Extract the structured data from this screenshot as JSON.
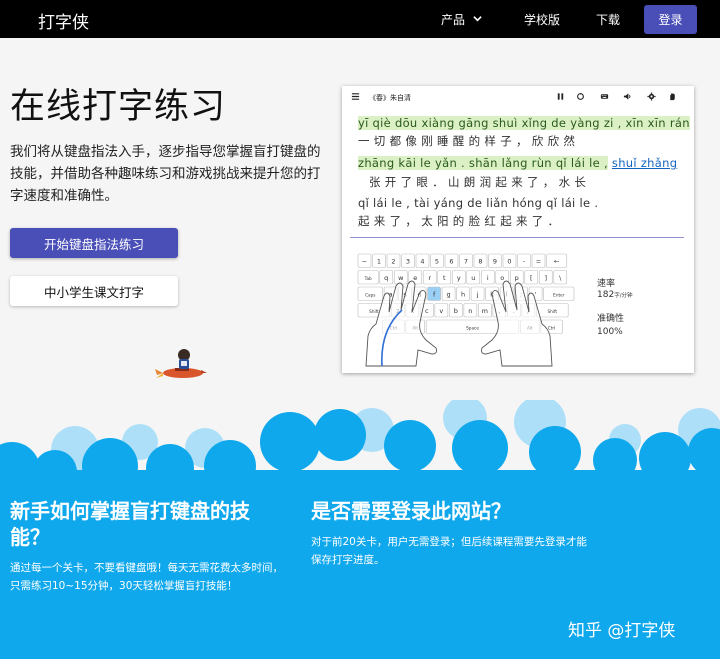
{
  "header": {
    "brand": "打字侠",
    "nav": {
      "product": "产品",
      "school": "学校版",
      "download": "下载",
      "login": "登录"
    }
  },
  "hero": {
    "title": "在线打字练习",
    "description": "我们将从键盘指法入手，逐步指导您掌握盲打键盘的技能，并借助各种趣味练习和游戏挑战来提升您的打字速度和准确性。",
    "primary_button": "开始键盘指法练习",
    "secondary_button": "中小学生课文打字"
  },
  "preview": {
    "title": "《春》朱自清",
    "lines": [
      {
        "pinyin_done": "yī qiè dōu xiàng gāng shuì xǐng de yàng zi , xīn xīn rán",
        "pinyin_rest": "",
        "hanzi": "一切都像刚睡醒的样子，欣欣然"
      },
      {
        "pinyin_done": "zhāng kāi le yǎn . shān lǎng rùn qǐ lái le ,",
        "pinyin_rest": "shuǐ zhǎng",
        "hanzi": "张开了眼．山朗润起来了，水长"
      },
      {
        "pinyin_done": "",
        "pinyin_rest": "qǐ lái le , tài yáng de liǎn hóng qǐ lái le .",
        "hanzi": "起来了，太阳的脸红起来了．"
      }
    ],
    "stats": {
      "speed_label": "速率",
      "speed_value": "182",
      "speed_unit": "字/分钟",
      "accuracy_label": "准确性",
      "accuracy_value": "100%"
    },
    "keyboard_rows": [
      [
        "~",
        "1",
        "2",
        "3",
        "4",
        "5",
        "6",
        "7",
        "8",
        "9",
        "0",
        "-",
        "=",
        "←"
      ],
      [
        "Tab",
        "q",
        "w",
        "e",
        "r",
        "t",
        "y",
        "u",
        "i",
        "o",
        "p",
        "[",
        "]",
        "\\"
      ],
      [
        "Caps",
        "a",
        "s",
        "d",
        "f",
        "g",
        "h",
        "j",
        "k",
        "l",
        ";",
        "'",
        "Enter"
      ],
      [
        "Shift",
        "z",
        "x",
        "c",
        "v",
        "b",
        "n",
        "m",
        ",",
        ".",
        "/",
        "Shift"
      ],
      [
        "Ctrl",
        "Alt",
        "Space",
        "Alt",
        "Ctrl"
      ]
    ]
  },
  "faq": {
    "q1": "新手如何掌握盲打键盘的技能？",
    "a1": "通过每一个关卡，不要看键盘哦！每天无需花费太多时间，只需练习10~15分钟，30天轻松掌握盲打技能！",
    "q2": "是否需要登录此网站？",
    "a2": "对于前20关卡，用户无需登录；但后续课程需要先登录才能保存打字进度。"
  },
  "watermark": "知乎 @打字侠",
  "colors": {
    "accent": "#4a4fb8",
    "sky": "#10a8ec",
    "typed_highlight": "#dcf0c6"
  }
}
